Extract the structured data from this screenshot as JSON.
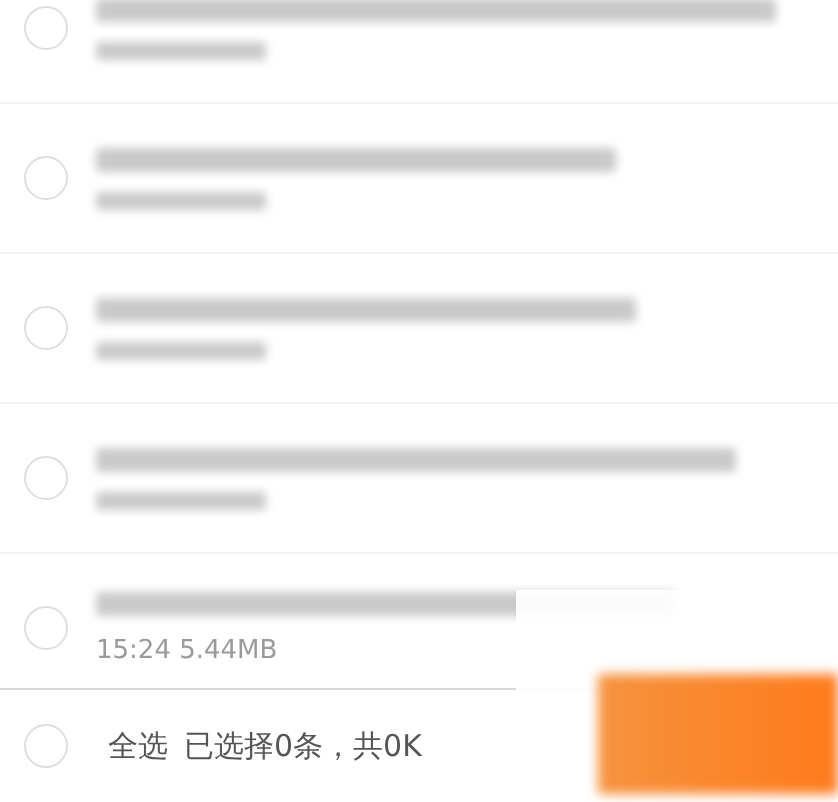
{
  "items": [
    {
      "checked": false
    },
    {
      "checked": false
    },
    {
      "checked": false
    },
    {
      "checked": false
    },
    {
      "checked": false,
      "meta": "15:24  5.44MB"
    }
  ],
  "footer": {
    "select_all": {
      "label": "全选",
      "checked": false
    },
    "summary": "已选择0条，共0K"
  }
}
